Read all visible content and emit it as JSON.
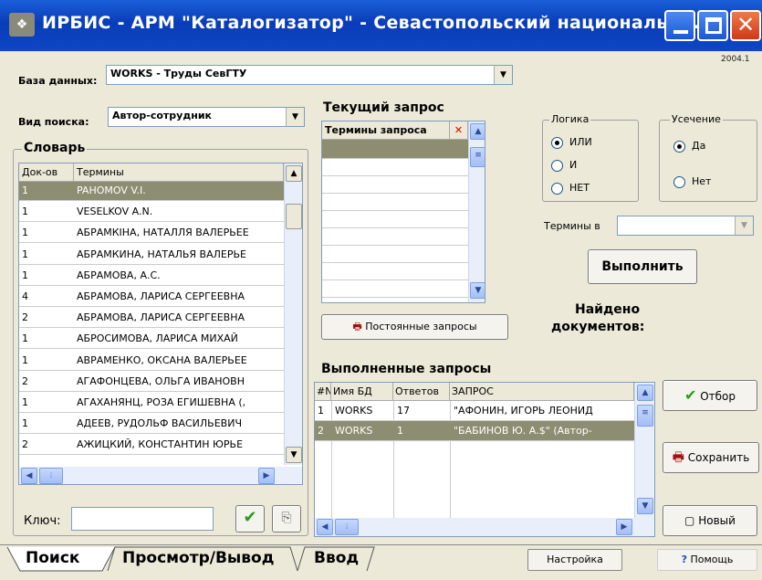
{
  "window": {
    "title": "ИРБИС - АРМ \"Каталогизатор\" - Севастопольский национальн...",
    "version": "2004.1",
    "icon": "irbis-app-icon"
  },
  "database": {
    "label": "База данных:",
    "value": "WORKS - Труды СевГТУ"
  },
  "search_type": {
    "label": "Вид поиска:",
    "value": "Автор-сотрудник"
  },
  "dictionary": {
    "title": "Словарь",
    "columns": [
      "Док-ов",
      "Термины"
    ],
    "rows": [
      {
        "count": "1",
        "term": "PAHOMOV V.I."
      },
      {
        "count": "1",
        "term": "VESELKOV A.N."
      },
      {
        "count": "1",
        "term": "АБРАМКІНА, НАТАЛЛЯ ВАЛЕРЬЕЕ"
      },
      {
        "count": "1",
        "term": "АБРАМКИНА, НАТАЛЬЯ ВАЛЕРЬЕ"
      },
      {
        "count": "1",
        "term": "АБРАМОВА, А.С."
      },
      {
        "count": "4",
        "term": "АБРАМОВА, ЛАРИСА СЕРГЕЕВНА"
      },
      {
        "count": "2",
        "term": "АБРАМОВА, ЛАРИСА СЕРГЕЕВНА"
      },
      {
        "count": "1",
        "term": "АБРОСИМОВА, ЛАРИСА МИХАЙ"
      },
      {
        "count": "1",
        "term": "АВРАМЕНКО, ОКСАНА ВАЛЕРЬЕЕ"
      },
      {
        "count": "2",
        "term": "АГАФОНЦЕВА, ОЛЬГА ИВАНОВН"
      },
      {
        "count": "1",
        "term": "АГАХАНЯНЦ, РОЗА ЕГИШЕВНА (,"
      },
      {
        "count": "1",
        "term": "АДЕЕВ, РУДОЛЬФ ВАСИЛЬЕВИЧ"
      },
      {
        "count": "2",
        "term": "АЖИЦКИЙ, КОНСТАНТИН ЮРЬЕ"
      }
    ]
  },
  "key": {
    "label": "Ключ:",
    "value": ""
  },
  "current_query": {
    "title": "Текущий запрос",
    "column": "Термины запроса",
    "permanent_button": "Постоянные запросы"
  },
  "logic": {
    "title": "Логика",
    "options": [
      "ИЛИ",
      "И",
      "НЕТ"
    ],
    "selected": "ИЛИ"
  },
  "truncation": {
    "title": "Усечение",
    "options": [
      "Да",
      "Нет"
    ],
    "selected": "Да"
  },
  "terms_in": {
    "label": "Термины в",
    "value": ""
  },
  "execute_button": "Выполнить",
  "found": {
    "line1": "Найдено",
    "line2": "документов:"
  },
  "done_queries": {
    "title": "Выполненные запросы",
    "columns": [
      "#N",
      "Имя БД",
      "Ответов",
      "ЗАПРОС"
    ],
    "rows": [
      {
        "n": "1",
        "db": "WORKS",
        "answers": "17",
        "query": "\"АФОНИН, ИГОРЬ ЛЕОНИД"
      },
      {
        "n": "2",
        "db": "WORKS",
        "answers": "1",
        "query": "\"БАБИНОВ Ю. А.$\" (Автор-"
      }
    ]
  },
  "side_buttons": {
    "select": "Отбор",
    "save": "Сохранить",
    "new": "Новый"
  },
  "tabs": [
    "Поиск",
    "Просмотр/Вывод",
    "Ввод"
  ],
  "bottom": {
    "settings": "Настройка",
    "help": "Помощь"
  },
  "colors": {
    "titlebar": "#0a3cb8",
    "selection": "#8d8d72",
    "face": "#ece9d8"
  }
}
